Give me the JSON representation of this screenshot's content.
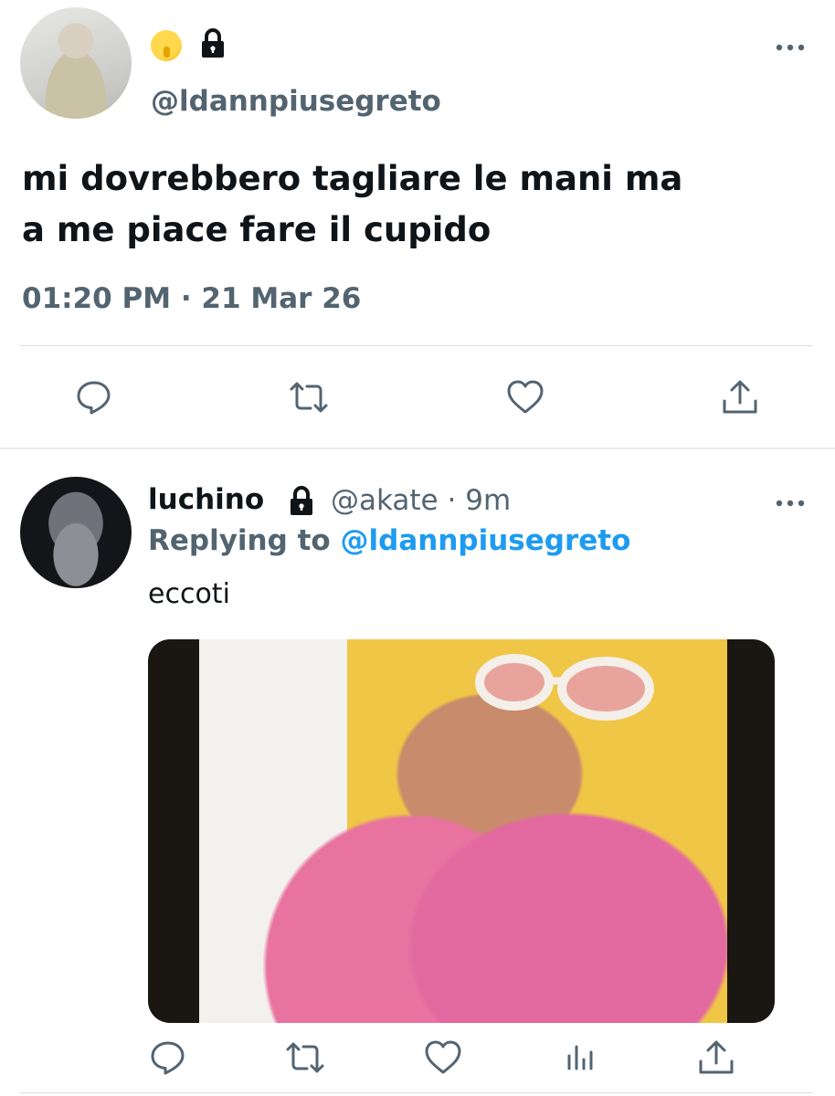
{
  "tweet": {
    "handle": "@ldannpiusegreto",
    "text_lines": [
      "mi dovrebbero tagliare le mani ma",
      "a me piace fare il cupido"
    ],
    "time": "01:20 PM",
    "date": "21 Mar 26"
  },
  "reply": {
    "name": "luchino",
    "handle": "@akate",
    "age": "9m",
    "replying_prefix": "Replying to",
    "replying_to": "@ldannpiusegreto",
    "text": "eccoti"
  },
  "colors": {
    "text": "#0f1419",
    "muted": "#536471",
    "accent": "#1d9bf0",
    "divider": "#d9dee2"
  },
  "icons": {
    "tweet_actions": [
      "reply-icon",
      "retweet-icon",
      "like-icon",
      "share-icon"
    ],
    "reply_actions": [
      "reply-icon",
      "retweet-icon",
      "like-icon",
      "analytics-icon",
      "share-icon"
    ]
  }
}
